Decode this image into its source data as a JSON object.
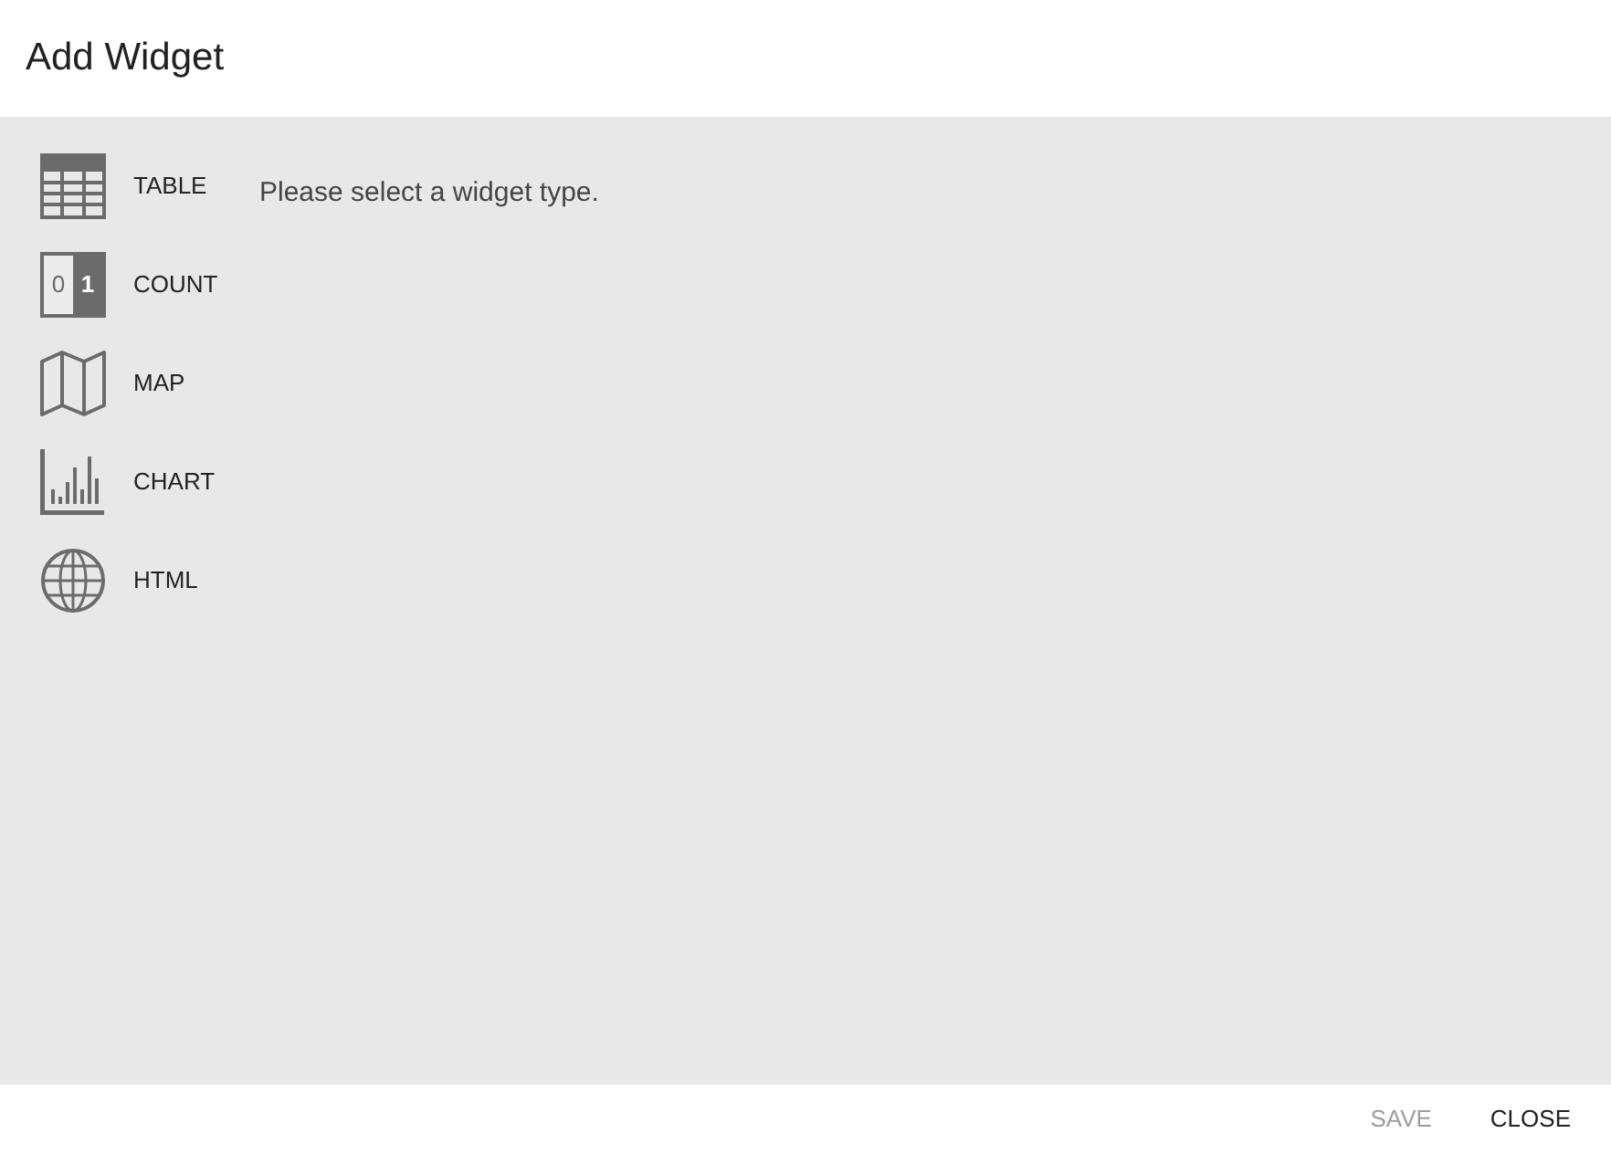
{
  "dialog": {
    "title": "Add Widget"
  },
  "widget_types": [
    {
      "kind": "table",
      "label": "TABLE"
    },
    {
      "kind": "count",
      "label": "COUNT",
      "icon_digits": [
        "0",
        "1"
      ]
    },
    {
      "kind": "map",
      "label": "MAP"
    },
    {
      "kind": "chart",
      "label": "CHART"
    },
    {
      "kind": "html",
      "label": "HTML"
    }
  ],
  "message": "Please select a widget type.",
  "buttons": [
    {
      "label": "SAVE",
      "disabled": true
    },
    {
      "label": "CLOSE",
      "disabled": false
    }
  ]
}
